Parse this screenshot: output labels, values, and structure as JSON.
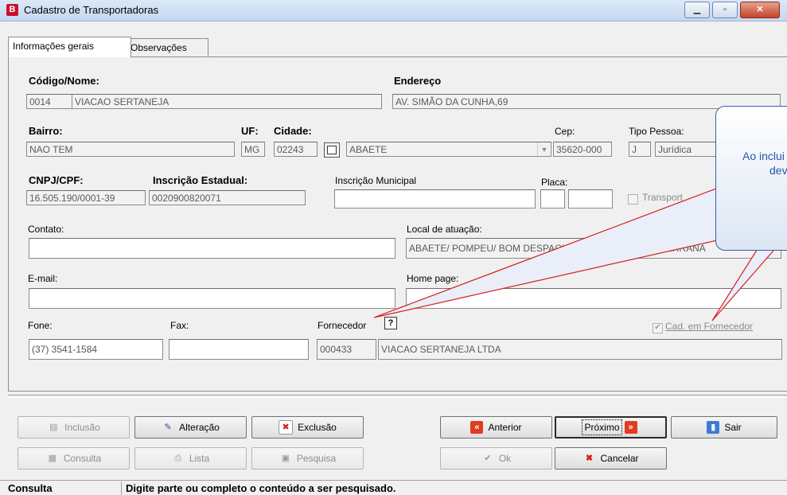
{
  "window": {
    "app_icon_letter": "B",
    "title": "Cadastro de Transportadoras",
    "minimize_icon": "minimize-icon",
    "maximize_icon": "maximize-icon",
    "close_icon": "close-icon",
    "minimize_glyph": "▁",
    "maximize_glyph": "▫",
    "close_glyph": "✕"
  },
  "tabs": [
    {
      "label": "Informações gerais"
    },
    {
      "label": "Observações"
    }
  ],
  "form": {
    "codigo_nome_label": "Código/Nome:",
    "codigo": "0014",
    "nome": "VIACAO SERTANEJA",
    "endereco_label": "Endereço",
    "endereco": "AV. SIMÃO DA CUNHA,69",
    "bairro_label": "Bairro:",
    "bairro": "NAO TEM",
    "uf_label": "UF:",
    "uf": "MG",
    "cidade_label": "Cidade:",
    "cidade_codigo": "02243",
    "cidade_nome": "ABAETE",
    "cep_label": "Cep:",
    "cep": "35620-000",
    "tipo_pessoa_label": "Tipo Pessoa:",
    "tipo_pessoa_codigo": "J",
    "tipo_pessoa": "Jurídica",
    "cnpj_label": "CNPJ/CPF:",
    "cnpj": "16.505.190/0001-39",
    "ie_label": "Inscrição Estadual:",
    "ie": "0020900820071",
    "im_label": "Inscrição Municipal",
    "im": "",
    "placa_label": "Placa:",
    "placa1": "",
    "placa2": "",
    "transport_label": "Transport",
    "contato_label": "Contato:",
    "contato": "",
    "local_label": "Local de atuação:",
    "local": "ABAETE/ POMPEU/ BOM DESPACHO/ PITANGUI/ NOVA SERRANA",
    "email_label": "E-mail:",
    "email": "",
    "homepage_label": "Home page:",
    "homepage": "",
    "fone_label": "Fone:",
    "fone": "(37) 3541-1584",
    "fax_label": "Fax:",
    "fax": "",
    "fornecedor_label": "Fornecedor",
    "fornecedor_help": "?",
    "fornecedor_codigo": "000433",
    "fornecedor_nome": "VIACAO SERTANEJA LTDA",
    "cad_fornecedor_label": "Cad. em Fornecedor",
    "cad_fornecedor_checked": true
  },
  "callout": {
    "line1": "Ao inclui",
    "line2": "dev"
  },
  "buttons": {
    "inclusao": {
      "label": "Inclusão",
      "icon": "insert-record-icon",
      "enabled": false
    },
    "alteracao": {
      "label": "Alteração",
      "icon": "edit-pencil-icon",
      "enabled": true
    },
    "exclusao": {
      "label": "Exclusão",
      "icon": "delete-x-icon",
      "enabled": true
    },
    "anterior": {
      "label": "Anterior",
      "icon": "previous-arrows-icon",
      "enabled": true
    },
    "proximo": {
      "label": "Próximo",
      "icon": "next-arrows-icon",
      "enabled": true
    },
    "sair": {
      "label": "Sair",
      "icon": "exit-door-icon",
      "enabled": true
    },
    "consulta": {
      "label": "Consulta",
      "icon": "query-icon",
      "enabled": false
    },
    "lista": {
      "label": "Lista",
      "icon": "printer-icon",
      "enabled": false
    },
    "pesquisa": {
      "label": "Pesquisa",
      "icon": "search-icon",
      "enabled": false
    },
    "ok": {
      "label": "Ok",
      "icon": "check-icon",
      "enabled": false
    },
    "cancelar": {
      "label": "Cancelar",
      "icon": "cancel-x-icon",
      "enabled": true
    }
  },
  "status": {
    "mode": "Consulta",
    "message": "Digite parte ou completo o conteúdo a ser pesquisado."
  },
  "colors": {
    "accent_red": "#c8102e",
    "callout_blue": "#2255aa",
    "arrow_red": "#d62020"
  }
}
